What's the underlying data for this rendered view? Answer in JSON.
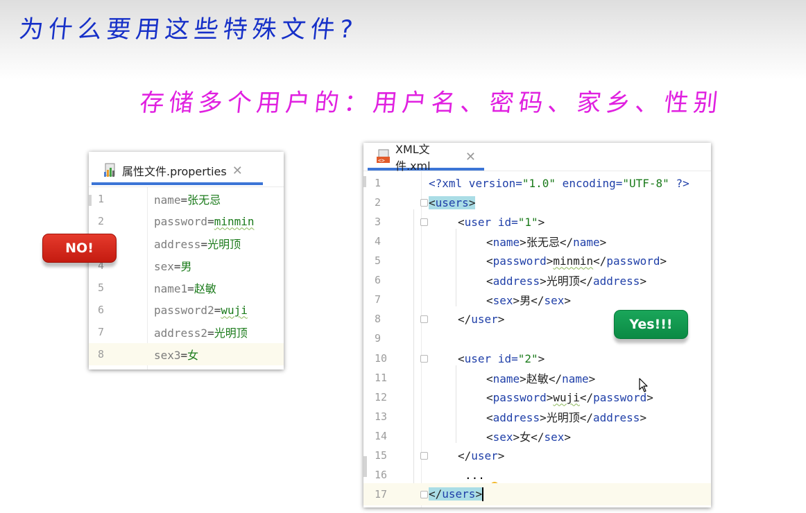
{
  "slide": {
    "title": "为什么要用这些特殊文件?",
    "subtitle": "存储多个用户的：用户名、密码、家乡、性别"
  },
  "properties_editor": {
    "tab": {
      "label": "属性文件.properties",
      "icon": "properties-file-icon",
      "close_icon": "close-icon"
    },
    "current_line": "8",
    "lines": [
      {
        "n": "1",
        "key": "name",
        "eq": "=",
        "value": "张无忌"
      },
      {
        "n": "2",
        "key": "password",
        "eq": "=",
        "value": "minmin"
      },
      {
        "n": "3",
        "key": "address",
        "eq": "=",
        "value": "光明顶"
      },
      {
        "n": "4",
        "key": "sex",
        "eq": "=",
        "value": "男"
      },
      {
        "n": "5",
        "key": "name1",
        "eq": "=",
        "value": "赵敏"
      },
      {
        "n": "6",
        "key": "password2",
        "eq": "=",
        "value": "wuji"
      },
      {
        "n": "7",
        "key": "address2",
        "eq": "=",
        "value": "光明顶"
      },
      {
        "n": "8",
        "key": "sex3",
        "eq": "=",
        "value": "女"
      }
    ]
  },
  "xml_editor": {
    "tab": {
      "label": "XML文件.xml",
      "icon": "xml-file-icon",
      "close_icon": "close-icon"
    },
    "line_numbers": [
      "1",
      "2",
      "3",
      "4",
      "5",
      "6",
      "7",
      "8",
      "9",
      "10",
      "11",
      "12",
      "13",
      "14",
      "15",
      "16",
      "17"
    ],
    "current_line": "17",
    "hint_icon": "lightbulb-icon",
    "l1": {
      "open": "<?",
      "tag": "xml",
      "a1": " version=",
      "v1": "\"1.0\"",
      "a2": " encoding=",
      "v2": "\"UTF-8\"",
      "close": " ?>"
    },
    "users_tag": "users",
    "user_tag": "user",
    "id_attr": " id=",
    "id1": "\"1\"",
    "id2": "\"2\"",
    "name_tag": "name",
    "password_tag": "password",
    "address_tag": "address",
    "sex_tag": "sex",
    "u1": {
      "name": "张无忌",
      "password": "minmin",
      "address": "光明顶",
      "sex": "男"
    },
    "u2": {
      "name": "赵敏",
      "password": "wuji",
      "address": "光明顶",
      "sex": "女"
    },
    "ellipsis": "...",
    "lt": "<",
    "lts": "</",
    "gt": ">"
  },
  "badges": {
    "no": "NO!",
    "yes": "Yes!!!"
  },
  "cursor_icon": "mouse-pointer-icon"
}
